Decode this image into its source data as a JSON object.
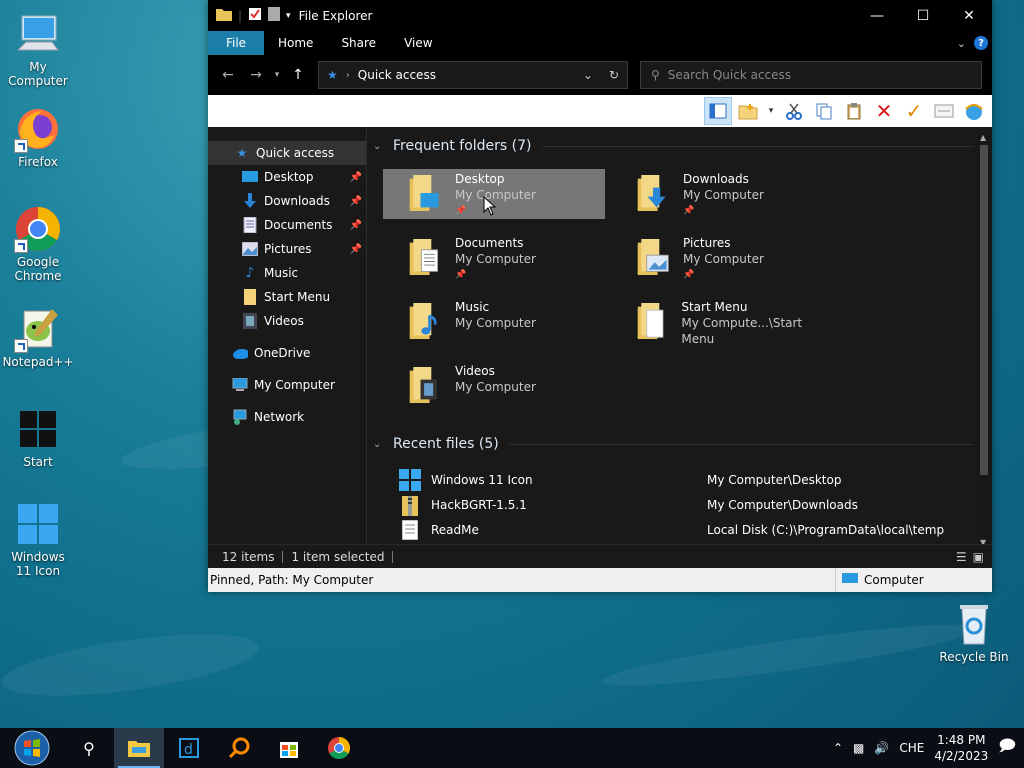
{
  "desktop_icons": [
    {
      "label": "My Computer",
      "icon": "computer-icon"
    },
    {
      "label": "Firefox",
      "icon": "firefox-icon"
    },
    {
      "label": "Google Chrome",
      "icon": "chrome-icon"
    },
    {
      "label": "Notepad++",
      "icon": "notepadpp-icon"
    },
    {
      "label": "Start",
      "icon": "windows-logo-icon"
    },
    {
      "label": "Windows 11 Icon",
      "icon": "windows11-icon"
    },
    {
      "label": "Recycle Bin",
      "icon": "recycle-bin-icon"
    }
  ],
  "explorer": {
    "title": "File Explorer",
    "ribbon_tabs": [
      "File",
      "Home",
      "Share",
      "View"
    ],
    "address": "Quick access",
    "search_placeholder": "Search Quick access",
    "nav": {
      "quick_access": "Quick access",
      "items": [
        {
          "label": "Desktop",
          "pinned": true,
          "icon": "desktop-icon"
        },
        {
          "label": "Downloads",
          "pinned": true,
          "icon": "downloads-icon"
        },
        {
          "label": "Documents",
          "pinned": true,
          "icon": "documents-icon"
        },
        {
          "label": "Pictures",
          "pinned": true,
          "icon": "pictures-icon"
        },
        {
          "label": "Music",
          "pinned": false,
          "icon": "music-icon"
        },
        {
          "label": "Start Menu",
          "pinned": false,
          "icon": "folder-icon"
        },
        {
          "label": "Videos",
          "pinned": false,
          "icon": "videos-icon"
        }
      ],
      "onedrive": "OneDrive",
      "computer": "My Computer",
      "network": "Network"
    },
    "frequent": {
      "header": "Frequent folders (7)",
      "items": [
        {
          "name": "Desktop",
          "location": "My Computer",
          "pinned": true
        },
        {
          "name": "Downloads",
          "location": "My Computer",
          "pinned": true
        },
        {
          "name": "Documents",
          "location": "My Computer",
          "pinned": true
        },
        {
          "name": "Pictures",
          "location": "My Computer",
          "pinned": true
        },
        {
          "name": "Music",
          "location": "My Computer",
          "pinned": false
        },
        {
          "name": "Start Menu",
          "location": "My Compute...\\Start Menu",
          "pinned": false
        },
        {
          "name": "Videos",
          "location": "My Computer",
          "pinned": false
        }
      ]
    },
    "recent": {
      "header": "Recent files (5)",
      "items": [
        {
          "name": "Windows 11 Icon",
          "path": "My Computer\\Desktop"
        },
        {
          "name": "HackBGRT-1.5.1",
          "path": "My Computer\\Downloads"
        },
        {
          "name": "ReadMe",
          "path": "Local Disk (C:)\\ProgramData\\local\\temp"
        }
      ]
    },
    "status": {
      "items": "12 items",
      "selected": "1 item selected"
    },
    "info": {
      "left": "Pinned, Path: My Computer",
      "right": "Computer"
    }
  },
  "taskbar": {
    "tray": {
      "lang": "CHE",
      "time": "1:48 PM",
      "date": "4/2/2023"
    }
  }
}
